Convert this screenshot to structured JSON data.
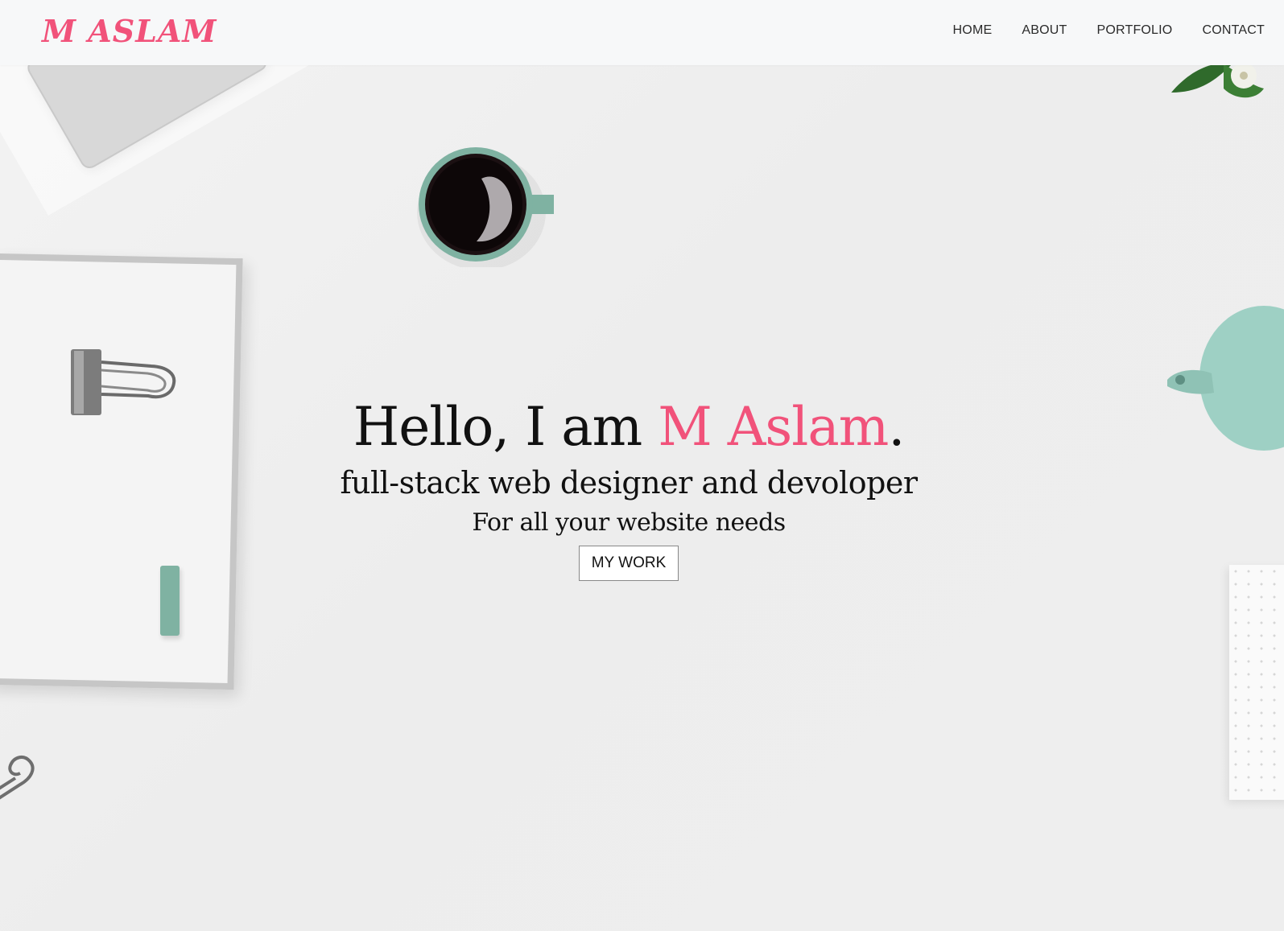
{
  "navbar": {
    "brand": "M ASLAM",
    "links": [
      "HOME",
      "ABOUT",
      "PORTFOLIO",
      "CONTACT"
    ]
  },
  "hero": {
    "greeting": "Hello, I am ",
    "name": "M Aslam",
    "period": ".",
    "subtitle": "full-stack web designer and devoloper",
    "tagline": "For all your website needs",
    "cta": "MY WORK"
  },
  "colors": {
    "accent": "#f1527a",
    "navbar_bg": "#f7f8f9",
    "page_bg": "#ededed",
    "text": "#111111",
    "mint": "#7fb2a2"
  },
  "icons": [
    "coffee-cup-icon",
    "binder-clip-icon",
    "paperclip-icon",
    "plant-icon",
    "teapot-icon"
  ]
}
